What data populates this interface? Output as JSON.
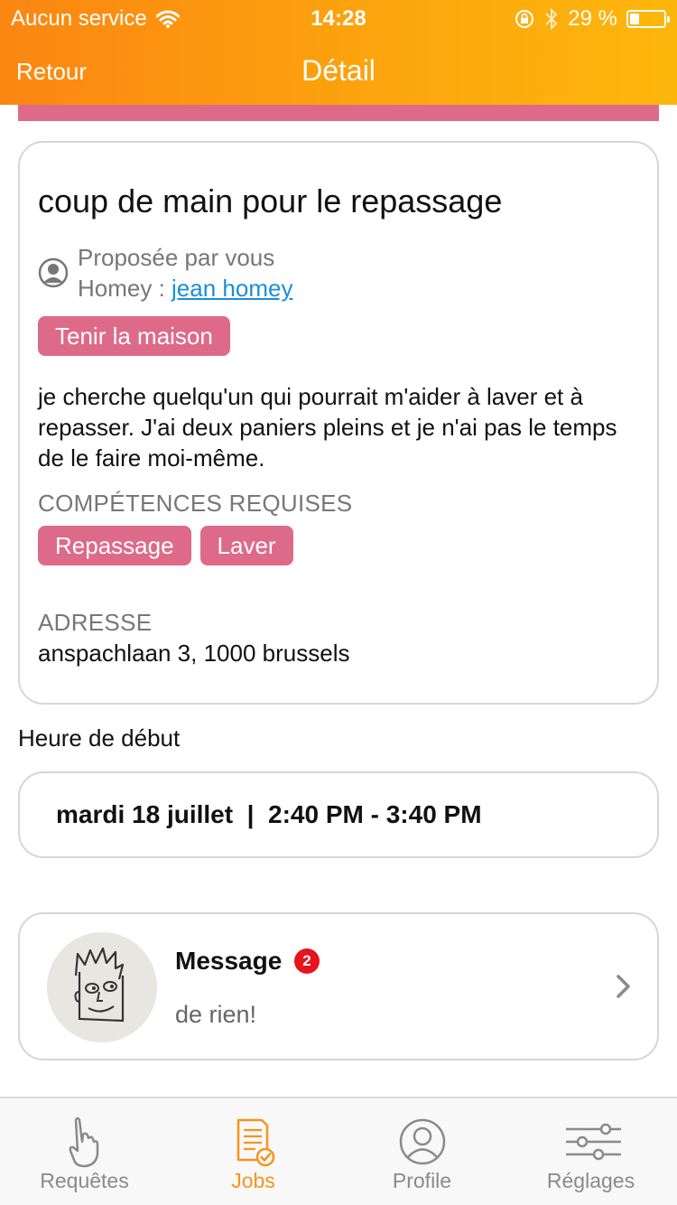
{
  "status_bar": {
    "carrier": "Aucun service",
    "time": "14:28",
    "battery_percent": "29 %",
    "battery_level": 0.29
  },
  "nav": {
    "back_label": "Retour",
    "title": "Détail"
  },
  "colors": {
    "header_gradient_start": "#fb8612",
    "header_gradient_end": "#fdb70c",
    "tag_pink": "#de6a8a",
    "link_blue": "#1a8fd8",
    "active_tab": "#f7941d",
    "badge_red": "#e8131b"
  },
  "job": {
    "title": "coup de main pour le repassage",
    "proposer_line": "Proposée par vous",
    "homey_label": "Homey : ",
    "homey_name": "jean homey",
    "category": "Tenir la maison",
    "description": "je cherche quelqu'un qui pourrait m'aider à laver et à repasser. J'ai deux paniers pleins et je n'ai pas le temps de le faire moi-même.",
    "skills_label": "COMPÉTENCES REQUISES",
    "skills": [
      "Repassage",
      "Laver"
    ],
    "address_label": "ADRESSE",
    "address": "anspachlaan  3, 1000 brussels"
  },
  "schedule": {
    "label": "Heure de début",
    "value": "mardi 18 juillet  |  2:40 PM - 3:40 PM"
  },
  "message": {
    "title": "Message",
    "unread_count": "2",
    "preview": "de rien!"
  },
  "tabbar": {
    "tabs": [
      {
        "label": "Requêtes",
        "icon": "hand-pointing-icon",
        "active": false
      },
      {
        "label": "Jobs",
        "icon": "document-check-icon",
        "active": true
      },
      {
        "label": "Profile",
        "icon": "profile-icon",
        "active": false
      },
      {
        "label": "Réglages",
        "icon": "sliders-icon",
        "active": false
      }
    ]
  }
}
